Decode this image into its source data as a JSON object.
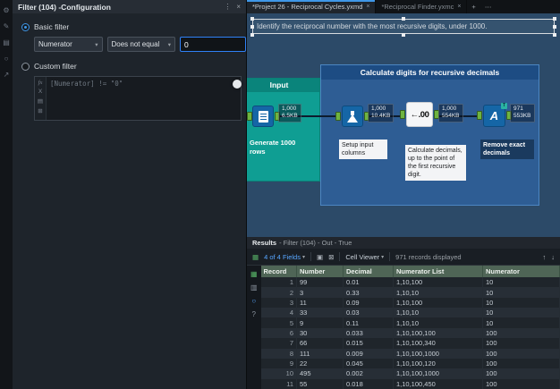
{
  "glyphs": {
    "kebab": "⋮",
    "close": "×",
    "caret": "▾",
    "plus": "+",
    "ellipsis": "⋯",
    "up_arrow": "↑",
    "down_arrow": "↓",
    "gear": "⚙",
    "pencil": "✎",
    "layers": "▤",
    "circle": "○",
    "share": "↗",
    "fx": "fx",
    "x_letter": "X",
    "folder": "▤",
    "grid_plus": "⊞",
    "check_box": "▣",
    "x_box": "⊠",
    "grid_green": "▦",
    "grid_gray": "▥",
    "lens": "○",
    "help": "?"
  },
  "config_panel": {
    "title": "Filter (104) -Configuration",
    "basic_filter_label": "Basic filter",
    "custom_filter_label": "Custom filter",
    "field_select": "Numerator",
    "operator_select": "Does not equal",
    "value_input": "0",
    "custom_expression": "[Numerator] != \"0\""
  },
  "tabs": {
    "tab1": "*Project 26 - Reciprocal Cycles.yxmd",
    "tab2": "*Reciprocal Finder.yxmc"
  },
  "canvas": {
    "comment": "Identify the reciprocal number with the most recursive digits, under 1000.",
    "input_container": {
      "title": "Input",
      "tool": {
        "label": "Generate 1000 rows",
        "count": "1,000",
        "size": "6.5KB"
      }
    },
    "calc_container": {
      "title": "Calculate digits for recursive decimals",
      "tools": [
        {
          "label": "Setup input columns",
          "count": "1,000",
          "size": "10.4KB"
        },
        {
          "label": "Calculate decimals, up to the point of the first recursive digit.",
          "count": "1,000",
          "size": "554KB",
          "icon_text": "←.00"
        },
        {
          "label": "Remove exact decimals",
          "count": "971",
          "size": "553KB",
          "badge": "T"
        }
      ]
    }
  },
  "results": {
    "title_prefix": "Results",
    "title_rest": "- Filter (104) - Out - True",
    "fields_label": "4 of 4 Fields",
    "cell_viewer_label": "Cell Viewer",
    "records_label": "971 records displayed",
    "table": {
      "columns": [
        "Record",
        "Number",
        "Decimal",
        "Numerator List",
        "Numerator"
      ],
      "rows": [
        [
          "1",
          "99",
          "0.01",
          "1,10,100",
          "10"
        ],
        [
          "2",
          "3",
          "0.33",
          "1,10,10",
          "10"
        ],
        [
          "3",
          "11",
          "0.09",
          "1,10,100",
          "10"
        ],
        [
          "4",
          "33",
          "0.03",
          "1,10,10",
          "10"
        ],
        [
          "5",
          "9",
          "0.11",
          "1,10,10",
          "10"
        ],
        [
          "6",
          "30",
          "0.033",
          "1,10,100,100",
          "100"
        ],
        [
          "7",
          "66",
          "0.015",
          "1,10,100,340",
          "100"
        ],
        [
          "8",
          "111",
          "0.009",
          "1,10,100,1000",
          "100"
        ],
        [
          "9",
          "22",
          "0.045",
          "1,10,100,120",
          "100"
        ],
        [
          "10",
          "495",
          "0.002",
          "1,10,100,1000",
          "100"
        ],
        [
          "11",
          "55",
          "0.018",
          "1,10,100,450",
          "100"
        ]
      ]
    }
  }
}
